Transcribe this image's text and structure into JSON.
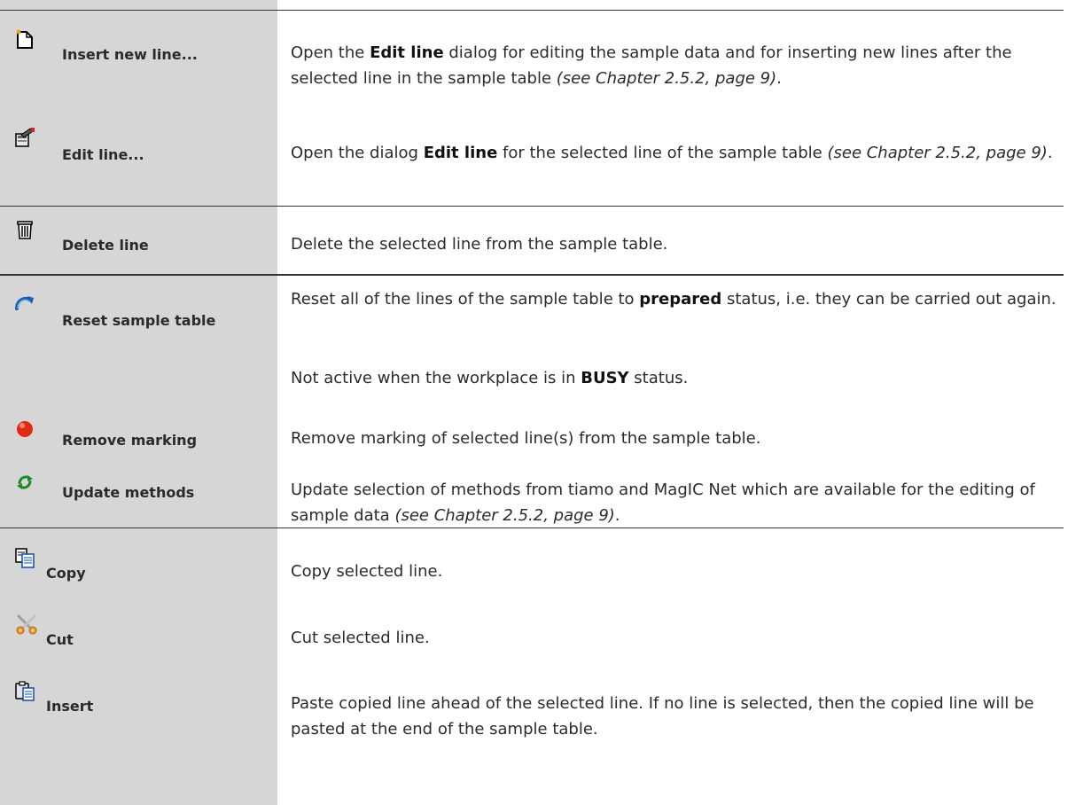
{
  "rows": [
    {
      "icon": "new-line-icon",
      "command": "Insert new line...",
      "desc": [
        {
          "t": "Open the "
        },
        {
          "t": "Edit line",
          "b": true
        },
        {
          "t": " dialog for editing the sample data and for inserting new lines after the selected line in the sample table "
        },
        {
          "t": "(see Chapter 2.5.2, page 9)",
          "i": true
        },
        {
          "t": "."
        }
      ]
    },
    {
      "icon": "edit-line-icon",
      "command": "Edit line...",
      "desc": [
        {
          "t": "Open the dialog "
        },
        {
          "t": "Edit line",
          "b": true
        },
        {
          "t": " for the selected line of the sample table "
        },
        {
          "t": "(see Chapter 2.5.2, page 9)",
          "i": true
        },
        {
          "t": "."
        }
      ]
    },
    {
      "icon": "trash-icon",
      "command": "Delete line",
      "desc": [
        {
          "t": "Delete the selected line from the sample table."
        }
      ]
    },
    {
      "icon": "reset-arrow-icon",
      "command": "Reset sample table",
      "desc": [
        {
          "t": "Reset all of the lines of the sample table to "
        },
        {
          "t": "prepared",
          "b": true
        },
        {
          "t": " status, i.e. they can be carried out again."
        }
      ],
      "desc2": [
        {
          "t": "Not active when the workplace is in "
        },
        {
          "t": "BUSY",
          "b": true
        },
        {
          "t": " status."
        }
      ]
    },
    {
      "icon": "red-dot-icon",
      "command": "Remove marking",
      "desc": [
        {
          "t": "Remove marking of selected line(s) from the sample table."
        }
      ]
    },
    {
      "icon": "update-arrows-icon",
      "command": "Update methods",
      "desc": [
        {
          "t": "Update selection of methods from tiamo and MagIC Net which are available for the editing of sample data "
        },
        {
          "t": "(see Chapter 2.5.2, page 9)",
          "i": true
        },
        {
          "t": "."
        }
      ]
    },
    {
      "icon": "copy-icon",
      "command": "Copy",
      "desc": [
        {
          "t": "Copy selected line."
        }
      ]
    },
    {
      "icon": "scissors-icon",
      "command": "Cut",
      "desc": [
        {
          "t": "Cut selected line."
        }
      ]
    },
    {
      "icon": "paste-icon",
      "command": "Insert",
      "desc": [
        {
          "t": "Paste copied line ahead of the selected line. If no line is selected, then the copied line will be pasted at the end of the sample table."
        }
      ]
    }
  ]
}
